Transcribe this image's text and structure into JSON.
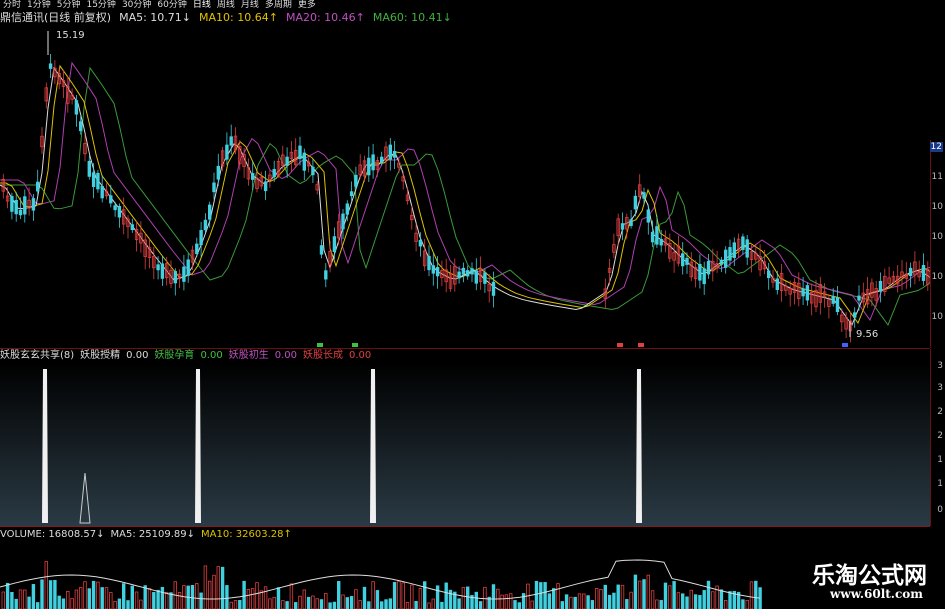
{
  "toolbar": {
    "items": [
      "分时",
      "1分钟",
      "5分钟",
      "15分钟",
      "30分钟",
      "60分钟",
      "日线",
      "周线",
      "月线",
      "多周期",
      "更多"
    ]
  },
  "main": {
    "title": "鼎信通讯(日线 前复权)",
    "ma5": "MA5: 10.71↓",
    "ma10": "MA10: 10.64↑",
    "ma20": "MA20: 10.46↑",
    "ma60": "MA60: 10.41↓",
    "high_label": "15.19",
    "low_label": "9.56",
    "axis_ticks": [
      "12",
      "11",
      "10",
      "10",
      "10",
      "10"
    ],
    "colors": {
      "ma5": "#dddddd",
      "ma10": "#e0c200",
      "ma20": "#b040b0",
      "ma60": "#3a9a3a",
      "up": "#e04040",
      "down": "#40d0e0"
    }
  },
  "indicator": {
    "name": "妖股玄玄共享(8)",
    "label1": "妖股授精",
    "val1": "0.00",
    "label2": "妖股孕育",
    "val2": "0.00",
    "label3": "妖股初生",
    "val3": "0.00",
    "label4": "妖股长成",
    "val4": "0.00",
    "axis_ticks": [
      "3",
      "3",
      "2",
      "2",
      "1",
      "1",
      "0"
    ]
  },
  "volume": {
    "name": "VOLUME: 16808.57↓",
    "ma5": "MA5: 25109.89↓",
    "ma10": "MA10: 32603.28↑"
  },
  "watermark": {
    "line1": "乐淘公式网",
    "line2": "www.60lt.com"
  }
}
